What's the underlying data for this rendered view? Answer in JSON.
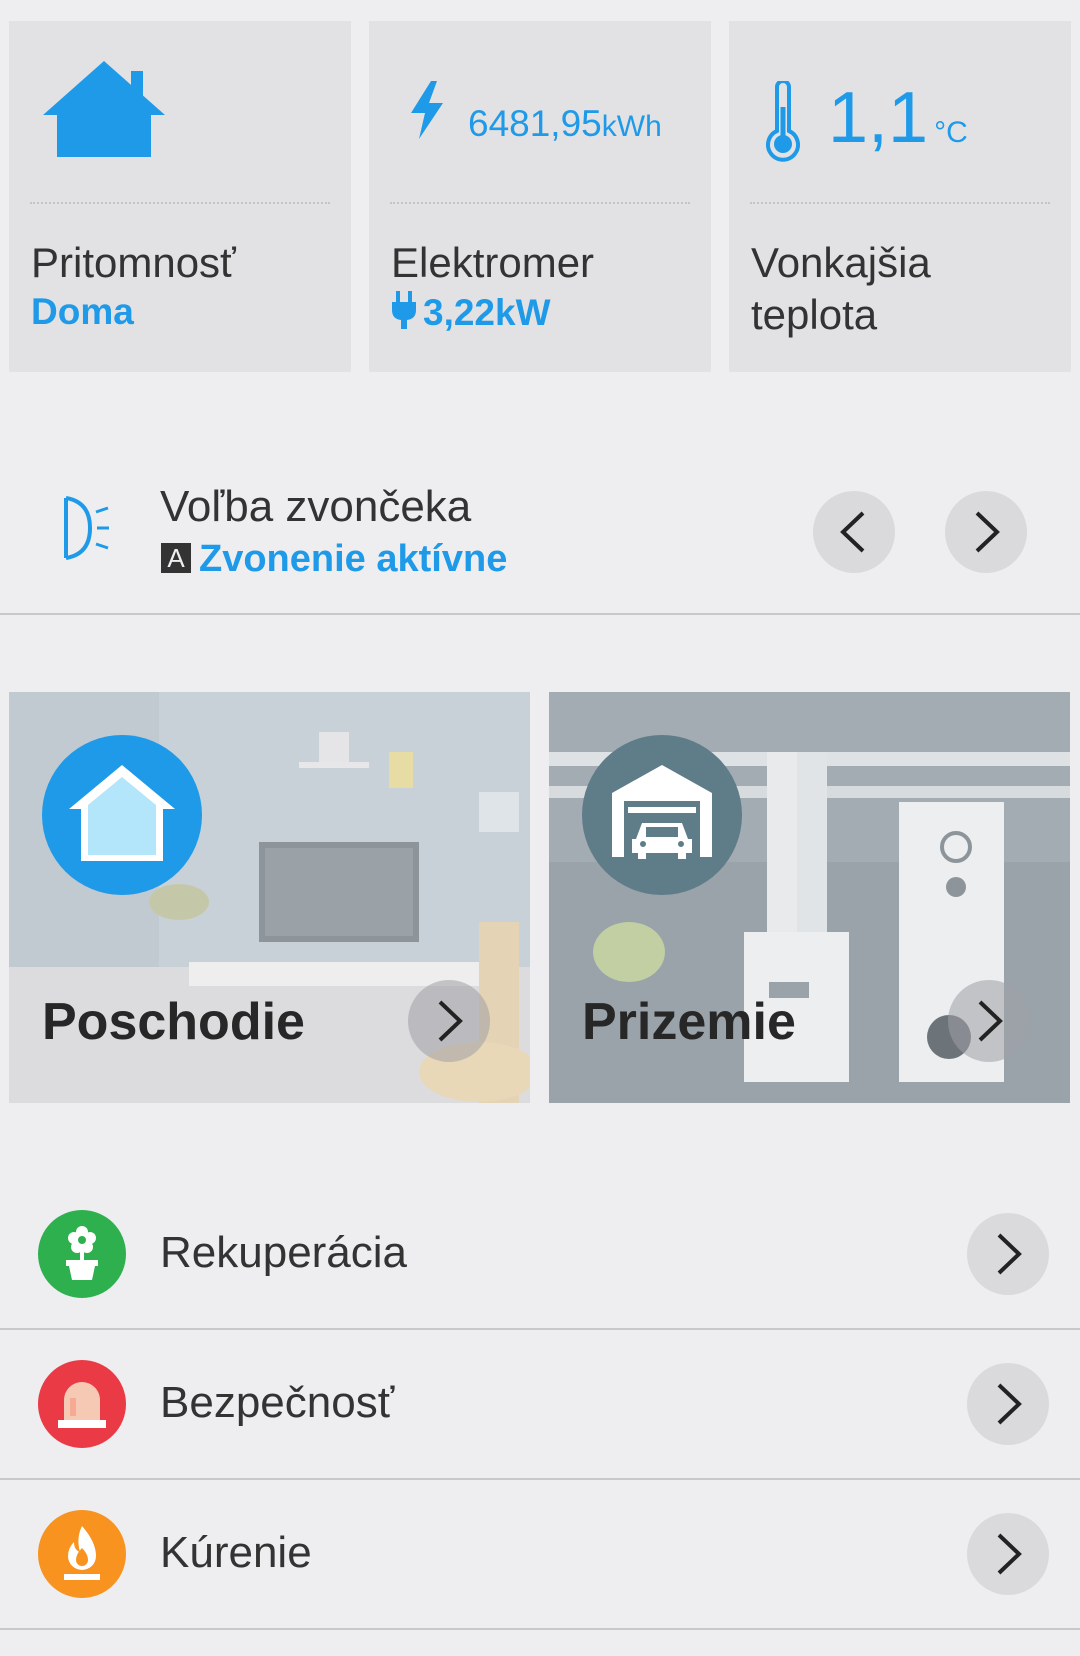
{
  "colors": {
    "accent": "#1e9ae8",
    "background": "#eeeef0",
    "tile": "#e2e2e4",
    "recuperation": "#2eb04e",
    "security": "#ea3a45",
    "heating": "#f7931e",
    "garage_circle": "#5f7c89"
  },
  "tiles": {
    "presence": {
      "icon": "house-icon",
      "title": "Pritomnosť",
      "status": "Doma"
    },
    "meter": {
      "icon": "lightning-icon",
      "total_value": "6481,95",
      "total_unit": "kWh",
      "title": "Elektromer",
      "power_icon": "plug-icon",
      "power": "3,22kW"
    },
    "outside_temp": {
      "icon": "thermometer-icon",
      "value": "1,1",
      "unit": "°C",
      "title_line1": "Vonkajšia",
      "title_line2": "teplota"
    }
  },
  "bell": {
    "icon": "bell-light-icon",
    "title": "Voľba zvončeka",
    "mode_badge": "A",
    "status": "Zvonenie aktívne",
    "prev_icon": "chevron-left-icon",
    "next_icon": "chevron-right-icon"
  },
  "floors": [
    {
      "label": "Poschodie",
      "icon": "house-icon"
    },
    {
      "label": "Prizemie",
      "icon": "garage-icon"
    }
  ],
  "categories": [
    {
      "label": "Rekuperácia",
      "icon": "flower-pot-icon"
    },
    {
      "label": "Bezpečnosť",
      "icon": "siren-icon"
    },
    {
      "label": "Kúrenie",
      "icon": "flame-icon"
    }
  ]
}
